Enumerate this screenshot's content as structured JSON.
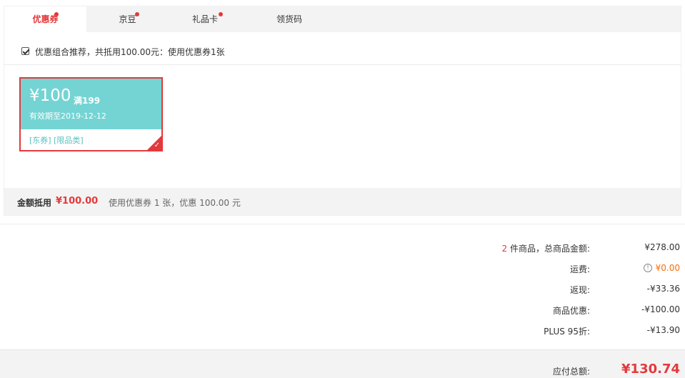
{
  "tabs": [
    {
      "label": "优惠券",
      "active": true,
      "dot": true
    },
    {
      "label": "京豆",
      "active": false,
      "dot": true
    },
    {
      "label": "礼品卡",
      "active": false,
      "dot": true
    },
    {
      "label": "领货码",
      "active": false,
      "dot": false
    }
  ],
  "combo": {
    "checked": true,
    "text": "优惠组合推荐，共抵用100.00元：使用优惠券1张"
  },
  "coupon": {
    "amount": "¥100",
    "condition": "满199",
    "validity": "有效期至2019-12-12",
    "tags": "[东券]  [限品类]",
    "selected": true,
    "color_top": "#74d4d3",
    "color_border": "#e4393c"
  },
  "summary": {
    "label": "金额抵用",
    "amount": "¥100.00",
    "desc": "使用优惠券 1 张，优惠 100.00 元"
  },
  "totals": {
    "count": "2",
    "goods_label_suffix": " 件商品，总商品金额:",
    "goods_value": "¥278.00",
    "shipping_label": "运费:",
    "shipping_value": "¥0.00",
    "cashback_label": "返现:",
    "cashback_value": "-¥33.36",
    "discount_label": "商品优惠:",
    "discount_value": "-¥100.00",
    "plus_label": "PLUS 95折:",
    "plus_value": "-¥13.90"
  },
  "pay": {
    "label": "应付总额:",
    "amount": "¥130.74"
  },
  "colors": {
    "accent": "#e4393c",
    "shipping": "#ff6a00",
    "coupon": "#74d4d3"
  }
}
